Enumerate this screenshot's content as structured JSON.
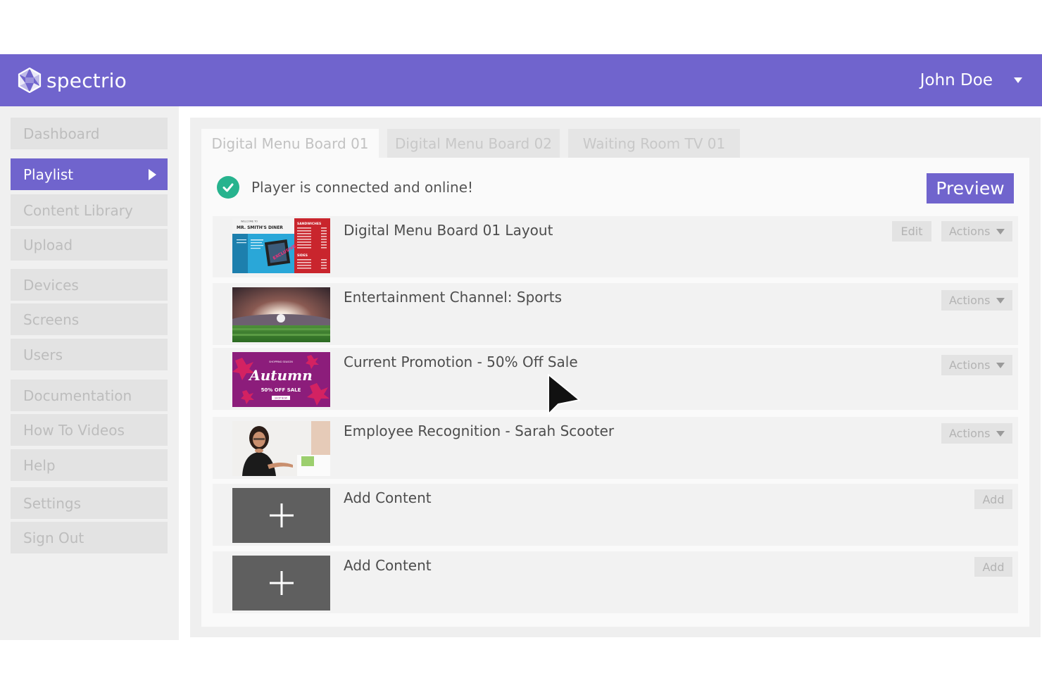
{
  "header": {
    "brand": "spectrio",
    "user_name": "John Doe",
    "colors": {
      "brand_bar": "#7064cd",
      "accent": "#7064cd",
      "online_check": "#27b38e"
    }
  },
  "sidebar": {
    "items": [
      {
        "label": "Dashboard",
        "active": false
      },
      {
        "label": "Playlist",
        "active": true
      },
      {
        "label": "Content Library",
        "active": false
      },
      {
        "label": "Upload",
        "active": false
      },
      {
        "label": "Devices",
        "active": false
      },
      {
        "label": "Screens",
        "active": false
      },
      {
        "label": "Users",
        "active": false
      },
      {
        "label": "Documentation",
        "active": false
      },
      {
        "label": "How To Videos",
        "active": false
      },
      {
        "label": "Help",
        "active": false
      },
      {
        "label": "Settings",
        "active": false
      },
      {
        "label": "Sign Out",
        "active": false
      }
    ]
  },
  "tabs": [
    {
      "label": "Digital Menu Board 01",
      "active": true
    },
    {
      "label": "Digital Menu Board 02",
      "active": false
    },
    {
      "label": "Waiting Room TV 01",
      "active": false
    }
  ],
  "status": {
    "text": "Player is connected and online!",
    "icon": "check-circle-icon"
  },
  "preview_label": "Preview",
  "playlist": {
    "items": [
      {
        "title": "Digital Menu Board 01 Layout",
        "edit_label": "Edit",
        "actions_label": "Actions",
        "thumb_text": {
          "welcome": "WELCOME TO",
          "diner": "MR. SMITH'S DINER",
          "sandwiches": "SANDWICHES",
          "sides": "SIDES",
          "promo": "EXCLUSIVE"
        }
      },
      {
        "title": "Entertainment Channel: Sports",
        "actions_label": "Actions"
      },
      {
        "title": "Current Promotion - 50% Off Sale",
        "actions_label": "Actions",
        "thumb_text": {
          "top": "SHOPPING SEASON",
          "script": "Autumn",
          "sale": "50% OFF SALE",
          "button": "SHOP NOW"
        }
      },
      {
        "title": "Employee Recognition - Sarah Scooter",
        "actions_label": "Actions"
      },
      {
        "title": "Add Content",
        "add_label": "Add"
      },
      {
        "title": "Add Content",
        "add_label": "Add"
      }
    ]
  }
}
